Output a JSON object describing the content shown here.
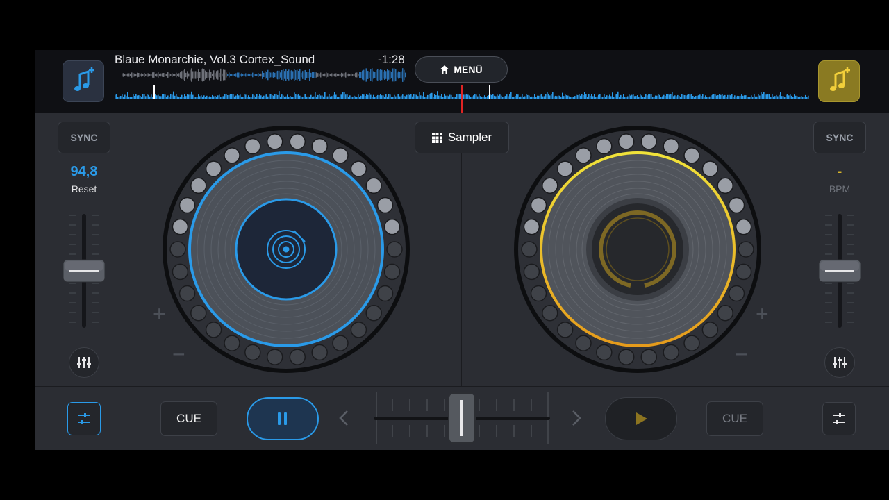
{
  "deck_left": {
    "add_track_icon": "music-note-plus-icon",
    "track_title": "Blaue Monarchie, Vol.3 Cortex_Sound",
    "remaining_time": "-1:28",
    "sync_label": "SYNC",
    "bpm_value": "94,8",
    "bpm_reset_label": "Reset",
    "pitch_fader": 0.5,
    "cue_label": "CUE",
    "state": "playing",
    "accent_color": "#2a9ae8"
  },
  "deck_right": {
    "add_track_icon": "music-note-plus-icon",
    "sync_label": "SYNC",
    "bpm_value": "-",
    "bpm_label": "BPM",
    "pitch_fader": 0.5,
    "cue_label": "CUE",
    "state": "paused",
    "accent_color": "#d9b62a"
  },
  "menu": {
    "label": "MENÜ",
    "icon": "home-icon"
  },
  "sampler": {
    "label": "Sampler",
    "icon": "grid-icon"
  },
  "crossfader": {
    "position": 0.5
  },
  "colors": {
    "background": "#2b2d33",
    "topbar": "#0f1014",
    "waveform": "#2a9ae8",
    "playhead": "#e02424"
  }
}
